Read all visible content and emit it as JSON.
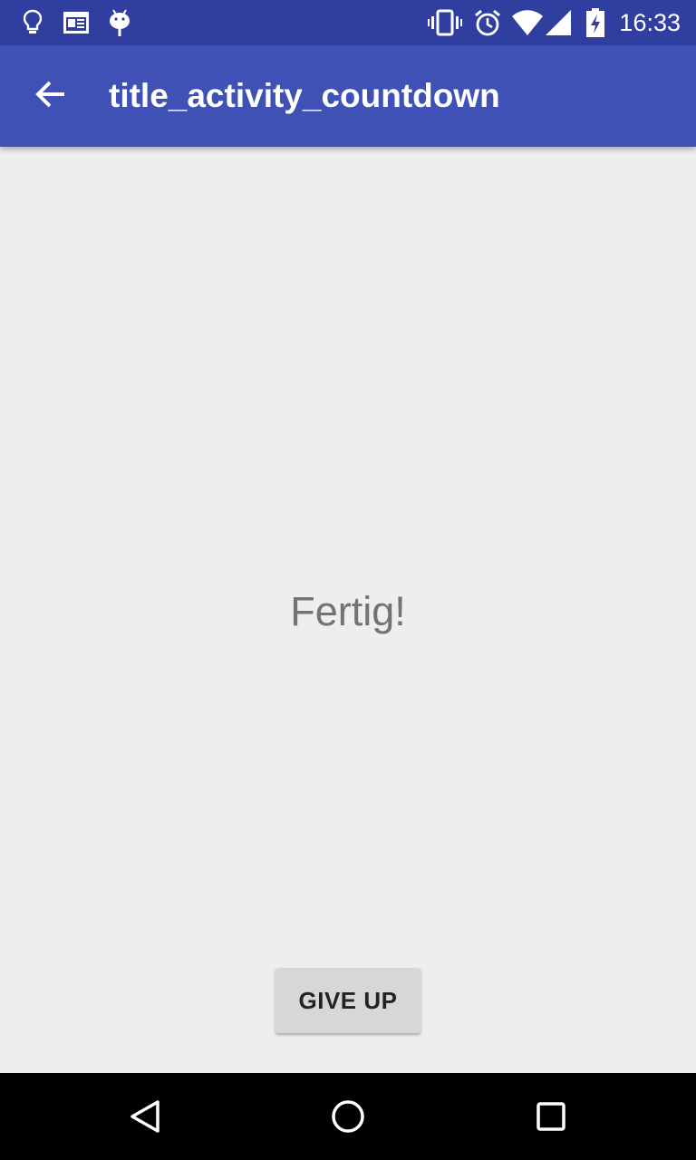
{
  "status_bar": {
    "time": "16:33",
    "left_icons": [
      "lightbulb-icon",
      "news-icon",
      "android-icon"
    ],
    "right_icons": [
      "vibrate-icon",
      "alarm-icon",
      "wifi-icon",
      "signal-icon",
      "battery-charging-icon"
    ]
  },
  "app_bar": {
    "title": "title_activity_countdown",
    "back_icon": "arrow-back-icon",
    "color": "#3f51b5"
  },
  "main": {
    "countdown_text": "Fertig!",
    "give_up_label": "GIVE UP"
  },
  "nav_bar": {
    "buttons": [
      "back-triangle-icon",
      "home-circle-icon",
      "recents-square-icon"
    ]
  },
  "colors": {
    "status_bar": "#303f9f",
    "app_bar": "#3f51b5",
    "background": "#eeeeee",
    "button": "#d6d7d7",
    "text_gray": "#737373"
  }
}
